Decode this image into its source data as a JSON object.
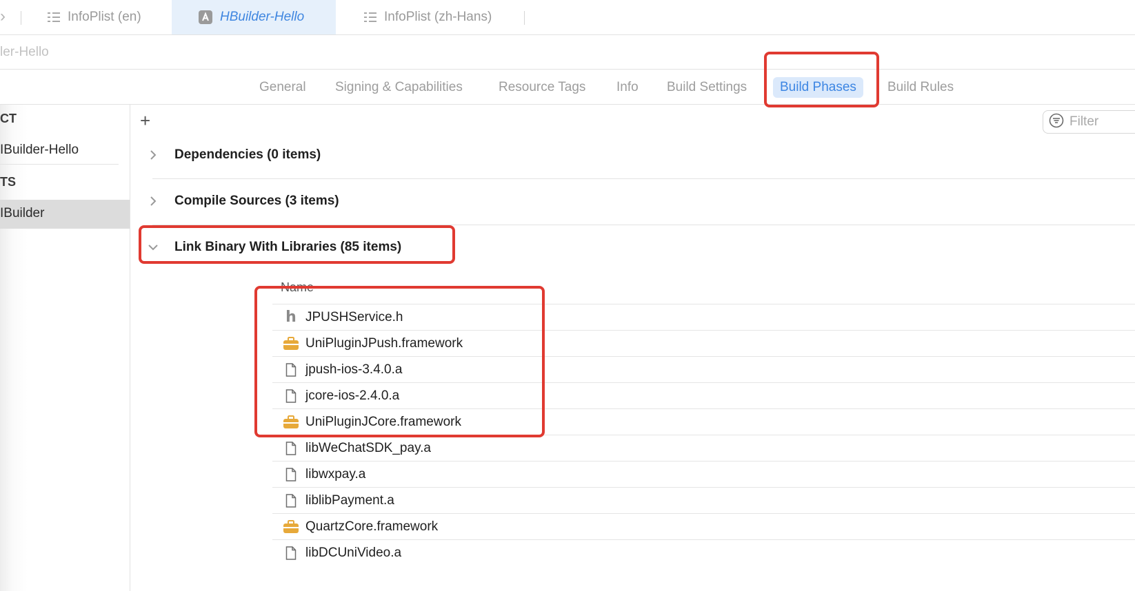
{
  "tabbar": {
    "tabs": [
      {
        "label": "InfoPlist (en)",
        "icon": "plist-icon",
        "active": false
      },
      {
        "label": "HBuilder-Hello",
        "icon": "xcodeproj-icon",
        "active": true
      },
      {
        "label": "InfoPlist (zh-Hans)",
        "icon": "plist-icon",
        "active": false
      }
    ]
  },
  "breadcrumb": {
    "text": "ler-Hello"
  },
  "editor_tabs": [
    {
      "label": "General",
      "active": false
    },
    {
      "label": "Signing & Capabilities",
      "active": false
    },
    {
      "label": "Resource Tags",
      "active": false
    },
    {
      "label": "Info",
      "active": false
    },
    {
      "label": "Build Settings",
      "active": false
    },
    {
      "label": "Build Phases",
      "active": true
    },
    {
      "label": "Build Rules",
      "active": false
    }
  ],
  "outline": {
    "project_header": "CT",
    "project_item": "IBuilder-Hello",
    "targets_header": "TS",
    "target_item": "IBuilder"
  },
  "toolbar": {
    "add_label": "+",
    "filter_placeholder": "Filter"
  },
  "phases": [
    {
      "label": "Dependencies (0 items)",
      "expanded": false
    },
    {
      "label": "Compile Sources (3 items)",
      "expanded": false
    },
    {
      "label": "Link Binary With Libraries (85 items)",
      "expanded": true
    }
  ],
  "libraries": {
    "column_header": "Name",
    "items": [
      {
        "name": "JPUSHService.h",
        "icon": "header-file-icon"
      },
      {
        "name": "UniPluginJPush.framework",
        "icon": "framework-icon"
      },
      {
        "name": "jpush-ios-3.4.0.a",
        "icon": "document-icon"
      },
      {
        "name": "jcore-ios-2.4.0.a",
        "icon": "document-icon"
      },
      {
        "name": "UniPluginJCore.framework",
        "icon": "framework-icon"
      },
      {
        "name": "libWeChatSDK_pay.a",
        "icon": "document-icon"
      },
      {
        "name": "libwxpay.a",
        "icon": "document-icon"
      },
      {
        "name": "liblibPayment.a",
        "icon": "document-icon"
      },
      {
        "name": "QuartzCore.framework",
        "icon": "framework-icon"
      },
      {
        "name": "libDCUniVideo.a",
        "icon": "document-icon"
      }
    ]
  },
  "colors": {
    "accent": "#3d86e3",
    "highlight": "#e03a31",
    "framework": "#e7a93a"
  }
}
